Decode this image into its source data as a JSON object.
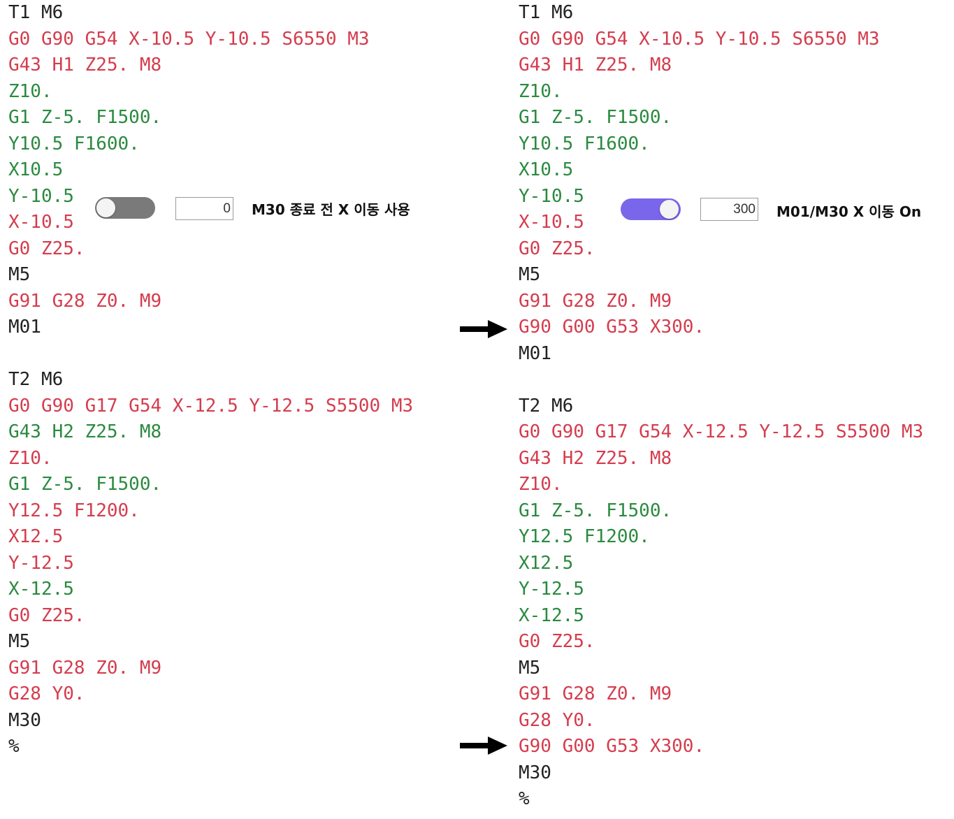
{
  "colors": {
    "red": "#d43d4e",
    "green": "#2a8a3f",
    "black": "#222222",
    "toggle_on": "#7966ea",
    "toggle_off": "#7a7a7a"
  },
  "left_panel": {
    "toggle": {
      "state": "off"
    },
    "input_value": "0",
    "label": "M30 종료 전 X 이동 사용",
    "lines": [
      {
        "text": "T1 M6",
        "color": "black"
      },
      {
        "text": "G0 G90 G54 X-10.5 Y-10.5 S6550 M3",
        "color": "red"
      },
      {
        "text": "G43 H1 Z25. M8",
        "color": "red"
      },
      {
        "text": "Z10.",
        "color": "green"
      },
      {
        "text": "G1 Z-5. F1500.",
        "color": "green"
      },
      {
        "text": "Y10.5 F1600.",
        "color": "green"
      },
      {
        "text": "X10.5",
        "color": "green"
      },
      {
        "text": "Y-10.5",
        "color": "green"
      },
      {
        "text": "X-10.5",
        "color": "red"
      },
      {
        "text": "G0 Z25.",
        "color": "red"
      },
      {
        "text": "M5",
        "color": "black"
      },
      {
        "text": "G91 G28 Z0. M9",
        "color": "red"
      },
      {
        "text": "M01",
        "color": "black"
      },
      {
        "text": "",
        "color": "blank"
      },
      {
        "text": "T2 M6",
        "color": "black"
      },
      {
        "text": "G0 G90 G17 G54 X-12.5 Y-12.5 S5500 M3",
        "color": "red"
      },
      {
        "text": "G43 H2 Z25. M8",
        "color": "green"
      },
      {
        "text": "Z10.",
        "color": "red"
      },
      {
        "text": "G1 Z-5. F1500.",
        "color": "green"
      },
      {
        "text": "Y12.5 F1200.",
        "color": "red"
      },
      {
        "text": "X12.5",
        "color": "red"
      },
      {
        "text": "Y-12.5",
        "color": "red"
      },
      {
        "text": "X-12.5",
        "color": "green"
      },
      {
        "text": "G0 Z25.",
        "color": "red"
      },
      {
        "text": "M5",
        "color": "black"
      },
      {
        "text": "G91 G28 Z0. M9",
        "color": "red"
      },
      {
        "text": "G28 Y0.",
        "color": "red"
      },
      {
        "text": "M30",
        "color": "black"
      },
      {
        "text": "%",
        "color": "black"
      }
    ]
  },
  "right_panel": {
    "toggle": {
      "state": "on"
    },
    "input_value": "300",
    "label": "M01/M30 X 이동 On",
    "lines": [
      {
        "text": "T1 M6",
        "color": "black"
      },
      {
        "text": "G0 G90 G54 X-10.5 Y-10.5 S6550 M3",
        "color": "red"
      },
      {
        "text": "G43 H1 Z25. M8",
        "color": "red"
      },
      {
        "text": "Z10.",
        "color": "green"
      },
      {
        "text": "G1 Z-5. F1500.",
        "color": "green"
      },
      {
        "text": "Y10.5 F1600.",
        "color": "green"
      },
      {
        "text": "X10.5",
        "color": "green"
      },
      {
        "text": "Y-10.5",
        "color": "green"
      },
      {
        "text": "X-10.5",
        "color": "red"
      },
      {
        "text": "G0 Z25.",
        "color": "red"
      },
      {
        "text": "M5",
        "color": "black"
      },
      {
        "text": "G91 G28 Z0. M9",
        "color": "red"
      },
      {
        "text": "G90 G00 G53 X300.",
        "color": "red"
      },
      {
        "text": "M01",
        "color": "black"
      },
      {
        "text": "",
        "color": "blank"
      },
      {
        "text": "T2 M6",
        "color": "black"
      },
      {
        "text": "G0 G90 G17 G54 X-12.5 Y-12.5 S5500 M3",
        "color": "red"
      },
      {
        "text": "G43 H2 Z25. M8",
        "color": "red"
      },
      {
        "text": "Z10.",
        "color": "red"
      },
      {
        "text": "G1 Z-5. F1500.",
        "color": "green"
      },
      {
        "text": "Y12.5 F1200.",
        "color": "green"
      },
      {
        "text": "X12.5",
        "color": "green"
      },
      {
        "text": "Y-12.5",
        "color": "green"
      },
      {
        "text": "X-12.5",
        "color": "green"
      },
      {
        "text": "G0 Z25.",
        "color": "red"
      },
      {
        "text": "M5",
        "color": "black"
      },
      {
        "text": "G91 G28 Z0. M9",
        "color": "red"
      },
      {
        "text": "G28 Y0.",
        "color": "red"
      },
      {
        "text": "G90 G00 G53 X300.",
        "color": "red"
      },
      {
        "text": "M30",
        "color": "black"
      },
      {
        "text": "%",
        "color": "black"
      }
    ]
  },
  "arrows": [
    {
      "icon": "right-arrow-icon"
    },
    {
      "icon": "right-arrow-icon"
    }
  ]
}
